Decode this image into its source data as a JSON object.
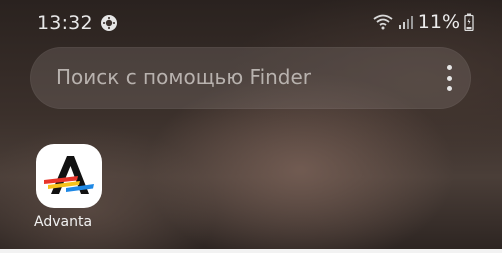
{
  "status_bar": {
    "time": "13:32",
    "battery_percent": "11%"
  },
  "search": {
    "placeholder": "Поиск с помощью Finder"
  },
  "apps": [
    {
      "label": "Advanta",
      "icon": "advanta-logo-icon"
    }
  ],
  "colors": {
    "status_text": "#e8e8e8",
    "search_bar": "#8c827d",
    "app_icon_bg": "#ffffff",
    "logo_black": "#111111",
    "logo_red": "#e8342a",
    "logo_yellow": "#f6c21a",
    "logo_blue": "#1e88e5"
  }
}
